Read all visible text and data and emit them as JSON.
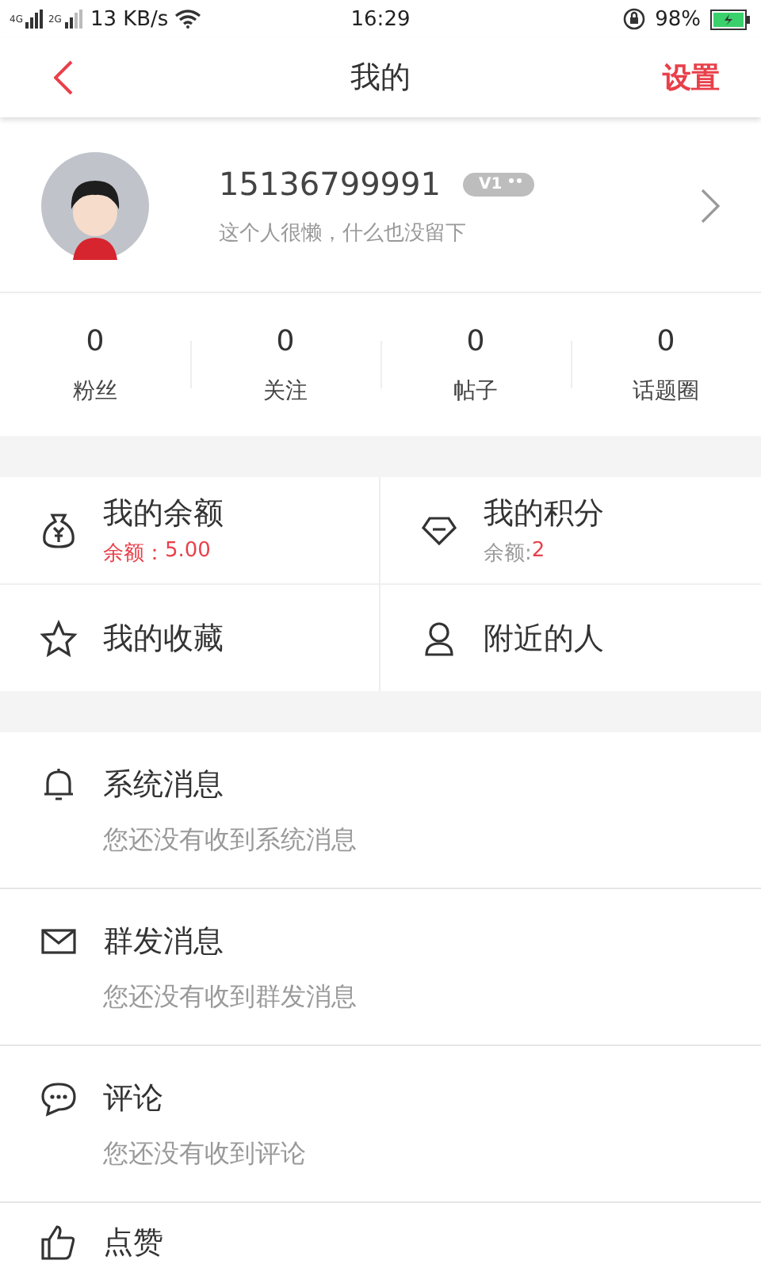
{
  "status_bar": {
    "network_1": "4G",
    "network_2": "2G",
    "speed": "13 KB/s",
    "time": "16:29",
    "battery": "98%"
  },
  "nav": {
    "title": "我的",
    "action": "设置"
  },
  "profile": {
    "name": "15136799991",
    "badge": "V1",
    "bio": "这个人很懒，什么也没留下"
  },
  "stats": [
    {
      "value": "0",
      "label": "粉丝"
    },
    {
      "value": "0",
      "label": "关注"
    },
    {
      "value": "0",
      "label": "帖子"
    },
    {
      "value": "0",
      "label": "话题圈"
    }
  ],
  "tiles": [
    {
      "kind": "wallet",
      "title": "我的余额",
      "sub_label": "余额：",
      "sub_value": "5.00",
      "color": "#e8404a"
    },
    {
      "kind": "diamond",
      "title": "我的积分",
      "sub_label": "余额:",
      "sub_value": "2",
      "color": "#999999"
    },
    {
      "kind": "star",
      "title": "我的收藏"
    },
    {
      "kind": "person",
      "title": "附近的人"
    }
  ],
  "messages": [
    {
      "kind": "bell",
      "title": "系统消息",
      "subtitle": "您还没有收到系统消息"
    },
    {
      "kind": "mail",
      "title": "群发消息",
      "subtitle": "您还没有收到群发消息"
    },
    {
      "kind": "comment",
      "title": "评论",
      "subtitle": "您还没有收到评论"
    },
    {
      "kind": "thumb",
      "title": "点赞"
    }
  ]
}
